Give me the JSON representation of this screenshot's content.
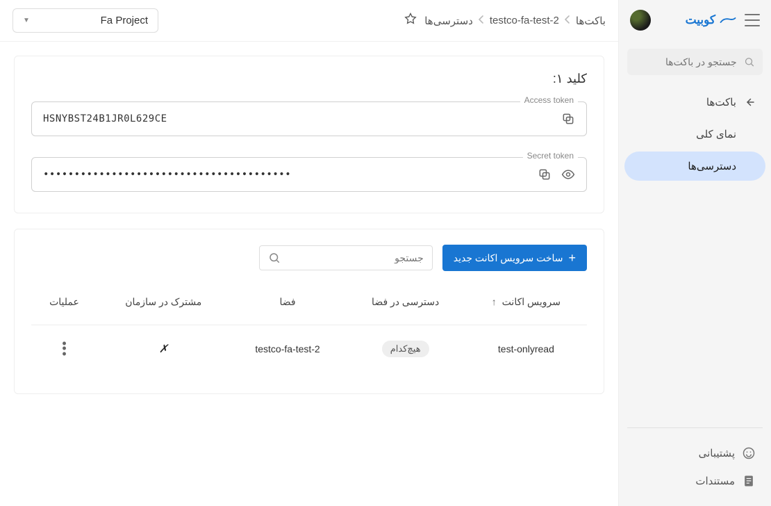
{
  "brand": "کوبیت",
  "sidebar": {
    "search_placeholder": "جستجو در باکت‌ها",
    "items": [
      {
        "label": "باکت‌ها",
        "active": false,
        "icon": "arrow"
      },
      {
        "label": "نمای کلی",
        "active": false,
        "icon": "none"
      },
      {
        "label": "دسترسی‌ها",
        "active": true,
        "icon": "none"
      }
    ],
    "bottom": [
      {
        "label": "پشتیبانی",
        "icon": "support"
      },
      {
        "label": "مستندات",
        "icon": "docs"
      }
    ]
  },
  "breadcrumb": {
    "root": "باکت‌ها",
    "bucket": "testco-fa-test-2",
    "page": "دسترسی‌ها"
  },
  "project_picker": "Fa Project",
  "key_section": {
    "title": "کلید ۱:",
    "access_label": "Access token",
    "access_value": "HSNYBST24B1JR0L629CE",
    "secret_label": "Secret token",
    "secret_value": "••••••••••••••••••••••••••••••••••••••••"
  },
  "actions": {
    "new_sa": "ساخت سرویس اکانت جدید",
    "search_placeholder": "جستجو"
  },
  "table": {
    "headers": {
      "sa": "سرویس اکانت",
      "space_access": "دسترسی در فضا",
      "space": "فضا",
      "shared": "مشترک در سازمان",
      "ops": "عملیات"
    },
    "rows": [
      {
        "sa": "test-onlyread",
        "space_access": "هیچ‌کدام",
        "space": "testco-fa-test-2",
        "shared": "✗"
      }
    ]
  }
}
